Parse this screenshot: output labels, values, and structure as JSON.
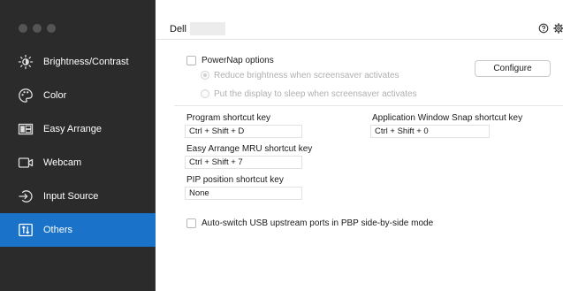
{
  "sidebar": {
    "items": [
      {
        "label": "Brightness/Contrast",
        "icon": "brightness-icon",
        "active": false
      },
      {
        "label": "Color",
        "icon": "palette-icon",
        "active": false
      },
      {
        "label": "Easy Arrange",
        "icon": "easy-arrange-icon",
        "active": false
      },
      {
        "label": "Webcam",
        "icon": "webcam-icon",
        "active": false
      },
      {
        "label": "Input Source",
        "icon": "input-source-icon",
        "active": false
      },
      {
        "label": "Others",
        "icon": "others-icon",
        "active": true
      }
    ]
  },
  "header": {
    "model": "Dell",
    "icons": [
      "help-icon",
      "gear-icon"
    ]
  },
  "powernap": {
    "label": "PowerNap options",
    "checked": false,
    "option_reduce": "Reduce brightness when screensaver activates",
    "option_sleep": "Put the display to sleep when screensaver activates",
    "configure_label": "Configure"
  },
  "shortcuts": {
    "program_label": "Program shortcut key",
    "program_value": "Ctrl + Shift + D",
    "easy_arrange_label": "Easy Arrange MRU shortcut key",
    "easy_arrange_value": "Ctrl + Shift + 7",
    "pip_label": "PIP position shortcut key",
    "pip_value": "None",
    "snap_label": "Application Window Snap shortcut key",
    "snap_value": "Ctrl + Shift + 0"
  },
  "usb": {
    "label": "Auto-switch USB upstream ports in PBP side-by-side mode",
    "checked": false
  },
  "colors": {
    "sidebar_bg": "#2b2b2b",
    "active_bg": "#1a73c8",
    "text": "#1a1a1a",
    "dim_text": "#b0b0b0"
  }
}
